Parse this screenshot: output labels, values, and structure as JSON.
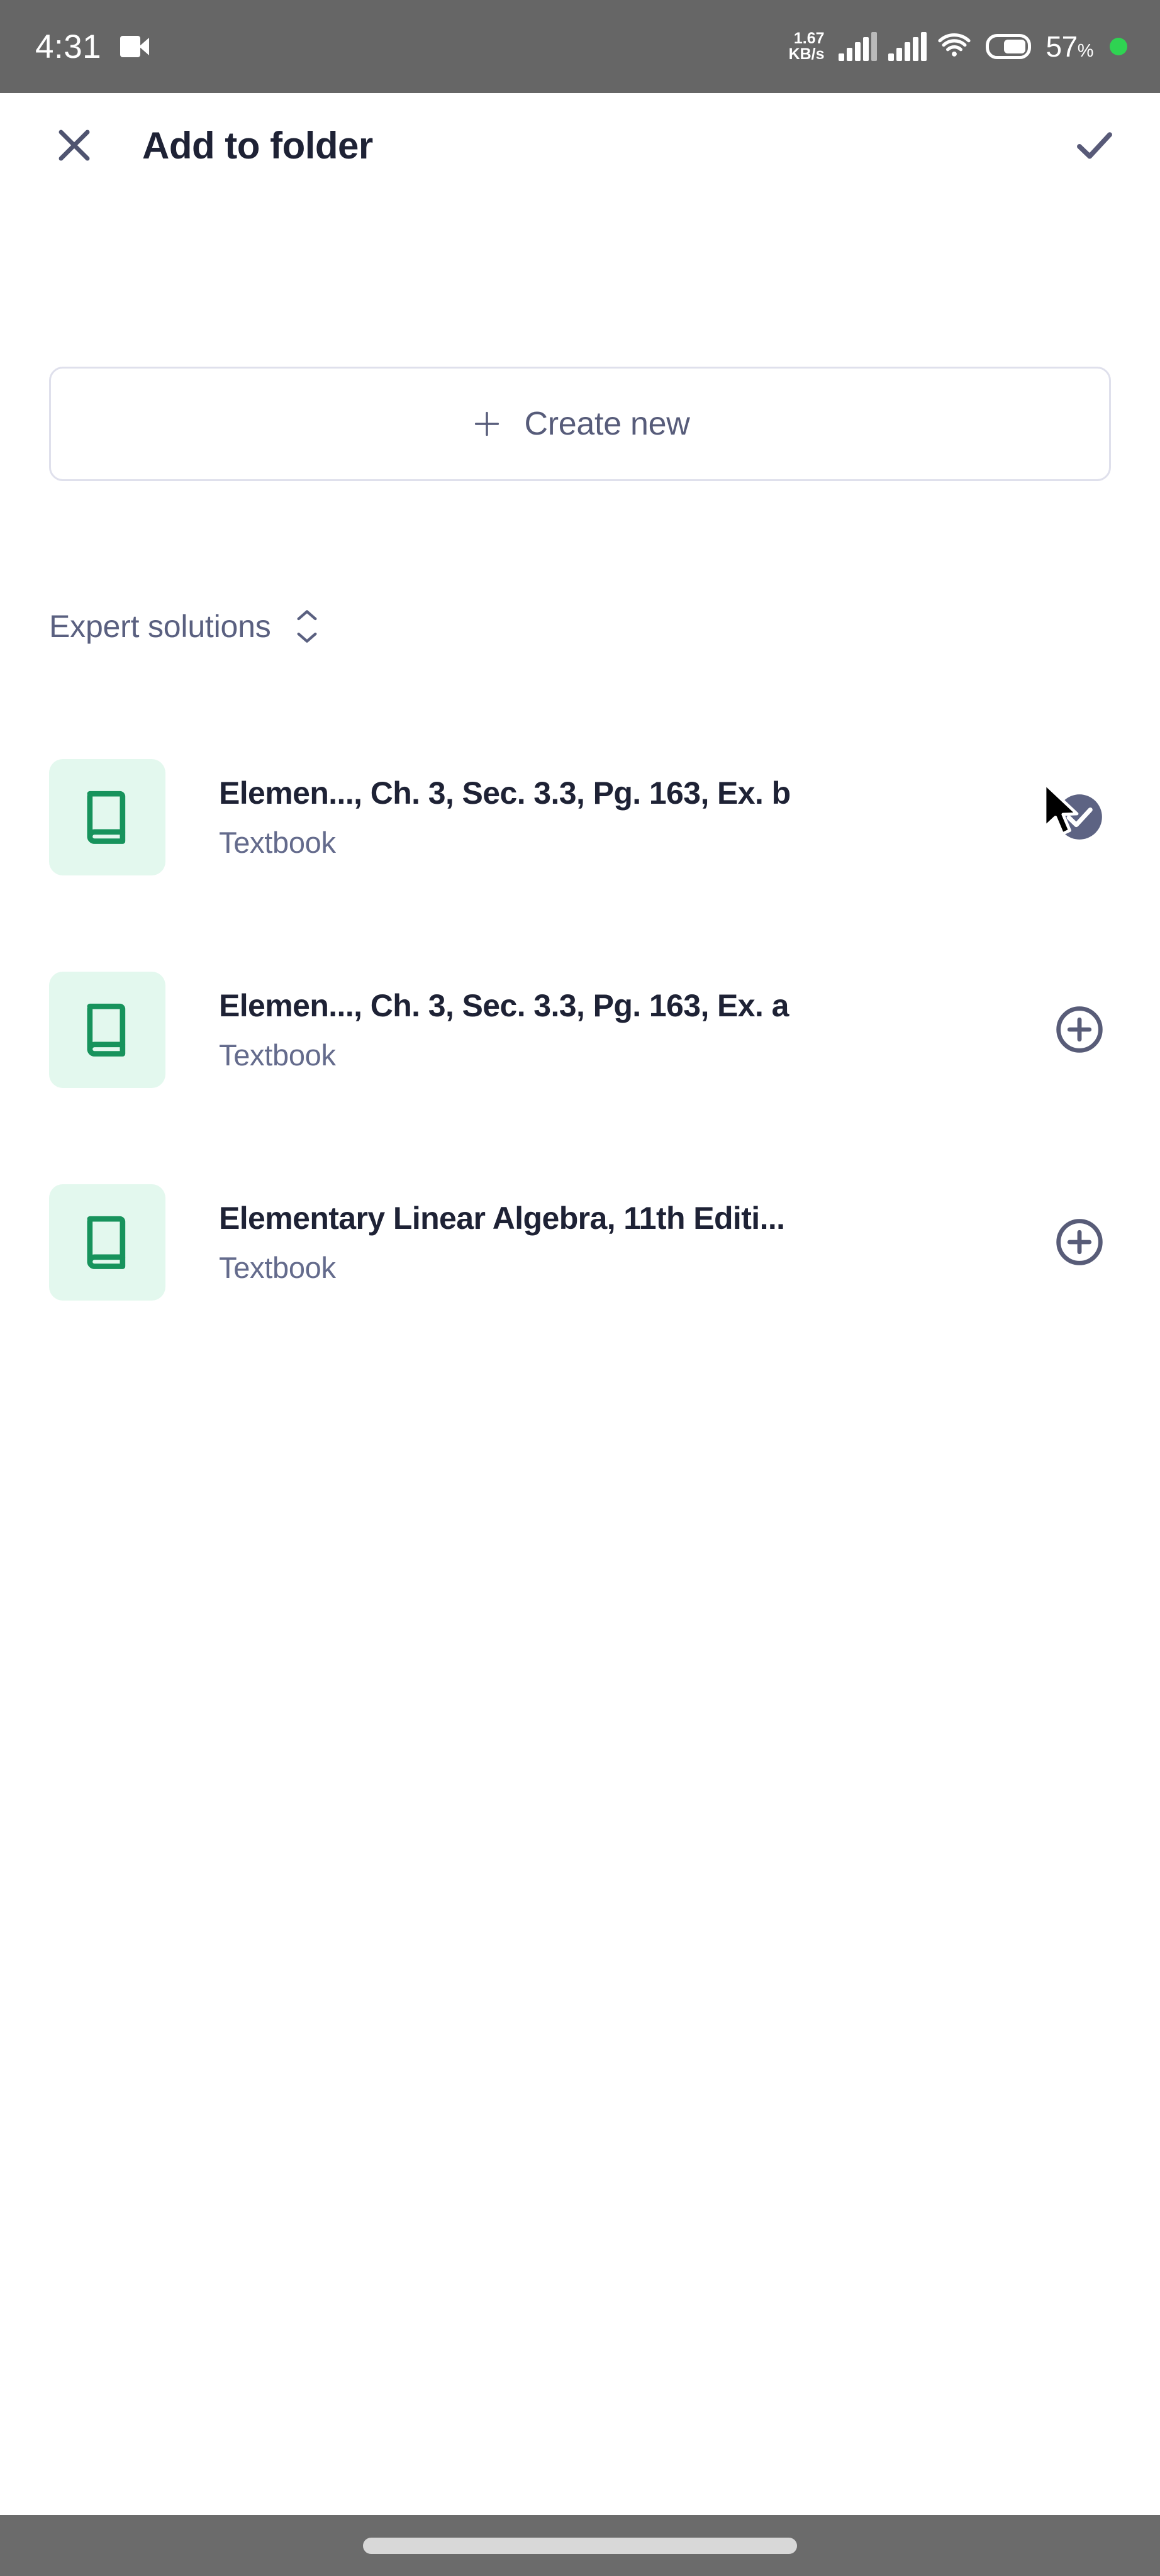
{
  "status_bar": {
    "time": "4:31",
    "recording_icon": "video-record-icon",
    "network_speed_value": "1.67",
    "network_speed_unit": "KB/s",
    "signal_icon_1": "cellular-signal-icon",
    "signal_icon_2": "cellular-signal-icon",
    "wifi_icon": "wifi-icon",
    "battery_icon": "battery-icon",
    "battery_percent": "57",
    "battery_percent_symbol": "%",
    "recording_dot": "recording-indicator-dot"
  },
  "header": {
    "close_icon": "close-icon",
    "title": "Add to folder",
    "confirm_icon": "check-icon"
  },
  "create_new": {
    "icon": "plus-icon",
    "label": "Create new"
  },
  "section": {
    "title": "Expert solutions",
    "sort_icon": "sort-chevrons-icon"
  },
  "items": [
    {
      "thumb_icon": "book-icon",
      "title": "Elemen..., Ch. 3, Sec. 3.3, Pg. 163, Ex. b",
      "subtitle": "Textbook",
      "action_icon": "check-circle-filled-icon",
      "selected": true
    },
    {
      "thumb_icon": "book-icon",
      "title": "Elemen..., Ch. 3, Sec. 3.3, Pg. 163, Ex. a",
      "subtitle": "Textbook",
      "action_icon": "plus-circle-icon",
      "selected": false
    },
    {
      "thumb_icon": "book-icon",
      "title": "Elementary Linear Algebra, 11th Editi...",
      "subtitle": "Textbook",
      "action_icon": "plus-circle-icon",
      "selected": false
    }
  ],
  "nav_bar": {
    "home_indicator": "home-indicator-pill"
  },
  "cursor": {
    "icon": "mouse-pointer-icon"
  },
  "colors": {
    "status_bar_bg": "#666666",
    "nav_bar_bg": "#6b6b6b",
    "page_bg": "#ffffff",
    "title_text": "#1e2235",
    "muted_text": "#646b8c",
    "accent_slate": "#585c7a",
    "border": "#dfe0ec",
    "thumb_bg": "#e3f8ee",
    "thumb_icon": "#17935c",
    "battery_dot_green": "#2fd352"
  }
}
